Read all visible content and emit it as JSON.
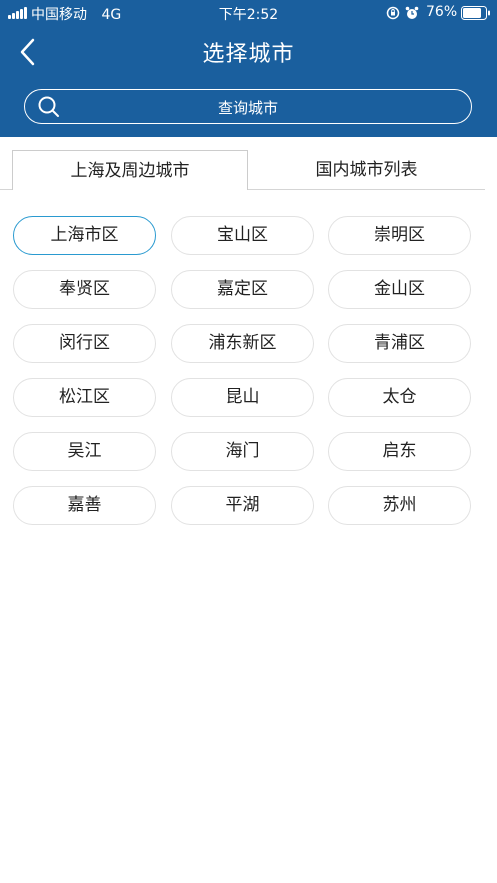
{
  "status_bar": {
    "carrier": "中国移动",
    "network": "4G",
    "time": "下午2:52",
    "battery": "76%"
  },
  "header": {
    "title": "选择城市",
    "search_placeholder": "查询城市",
    "background_color": "#1a5f9e"
  },
  "tabs": [
    {
      "label": "上海及周边城市",
      "active": true
    },
    {
      "label": "国内城市列表",
      "active": false
    }
  ],
  "cities": [
    {
      "name": "上海市区",
      "selected": true
    },
    {
      "name": "宝山区",
      "selected": false
    },
    {
      "name": "崇明区",
      "selected": false
    },
    {
      "name": "奉贤区",
      "selected": false
    },
    {
      "name": "嘉定区",
      "selected": false
    },
    {
      "name": "金山区",
      "selected": false
    },
    {
      "name": "闵行区",
      "selected": false
    },
    {
      "name": "浦东新区",
      "selected": false
    },
    {
      "name": "青浦区",
      "selected": false
    },
    {
      "name": "松江区",
      "selected": false
    },
    {
      "name": "昆山",
      "selected": false
    },
    {
      "name": "太仓",
      "selected": false
    },
    {
      "name": "吴江",
      "selected": false
    },
    {
      "name": "海门",
      "selected": false
    },
    {
      "name": "启东",
      "selected": false
    },
    {
      "name": "嘉善",
      "selected": false
    },
    {
      "name": "平湖",
      "selected": false
    },
    {
      "name": "苏州",
      "selected": false
    }
  ],
  "accent_color": "#2a9ad0"
}
